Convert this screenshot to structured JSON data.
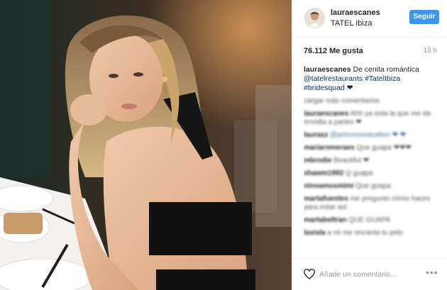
{
  "post": {
    "image_alt": ""
  },
  "header": {
    "username": "lauraescanes",
    "location": "TATEL Ibiza",
    "follow_label": "Seguir"
  },
  "stats": {
    "likes": "76.112 Me gusta",
    "time": "18 h"
  },
  "caption": {
    "username": "lauraescanes",
    "text": "De cenita romántica",
    "mention": "@tatelrestaurants",
    "hashtag1": "#TatelIbiza",
    "hashtag2": "#bridesquad",
    "emoji": "❤"
  },
  "blurred_comments": [
    {
      "user": "cargar más comentarios",
      "text": ""
    },
    {
      "user": "lauraescanes",
      "text": "Ahh ya esta la que me da envidia a partes ❤"
    },
    {
      "user": "laurasz",
      "text": "@princessvacation ❤ ❤"
    },
    {
      "user": "mariaromeraes",
      "text": "Que guapa ❤❤❤"
    },
    {
      "user": "mbrodie",
      "text": "Beautiful ❤"
    },
    {
      "user": "shawm1992",
      "text": "Q guapa"
    },
    {
      "user": "ninoamosmimi",
      "text": "Que guapa"
    },
    {
      "user": "martafuentes",
      "text": "me pregunto cómo haces para estar así"
    },
    {
      "user": "martabeltran",
      "text": "QUE GUAPA"
    },
    {
      "user": "lasisla",
      "text": "a mi me encanta tu pelo"
    }
  ],
  "footer": {
    "comment_placeholder": "Añade un comentario..."
  },
  "colors": {
    "accent": "#3897f0",
    "link": "#003569",
    "muted": "#999999"
  },
  "icons": {
    "like": "heart-icon",
    "more": "more-options-icon"
  }
}
